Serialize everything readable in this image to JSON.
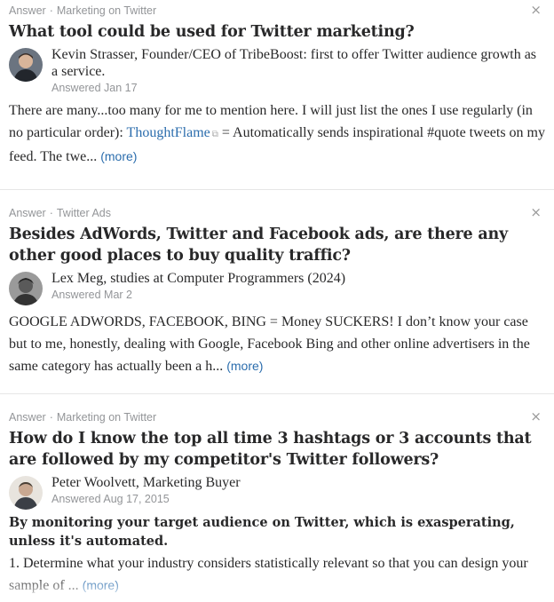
{
  "cards": [
    {
      "type_label": "Answer",
      "topic": "Marketing on Twitter",
      "close_glyph": "×",
      "question": "What tool could be used for Twitter marketing?",
      "author": "Kevin Strasser, Founder/CEO of TribeBoost: first to offer Twitter audience growth as a service.",
      "answered": "Answered Jan 17",
      "body_before_link": "There are many...too many for me to mention here. I will just list the ones I use regularly (in no particular order): ",
      "link_text": "ThoughtFlame",
      "body_after_link": " = Automatically sends inspirational #quote tweets on my feed. The twe... ",
      "more": "(more)"
    },
    {
      "type_label": "Answer",
      "topic": "Twitter Ads",
      "close_glyph": "×",
      "question": "Besides AdWords, Twitter and Facebook ads, are there any other good places to buy quality traffic?",
      "author": "Lex Meg, studies at Computer Programmers (2024)",
      "answered": "Answered Mar 2",
      "body": "GOOGLE ADWORDS, FACEBOOK, BING = Money SUCKERS! I don’t know your case but to me, honestly, dealing with Google, Facebook Bing and other online advertisers in the same category has actually been a h... ",
      "more": "(more)"
    },
    {
      "type_label": "Answer",
      "topic": "Marketing on Twitter",
      "close_glyph": "×",
      "question": "How do I know the top all time 3 hashtags or 3 accounts that are followed by my competitor's Twitter followers?",
      "author": "Peter Woolvett, Marketing Buyer",
      "answered": "Answered Aug 17, 2015",
      "lead": "By monitoring your target audience on Twitter, which is exasperating, unless it's automated.",
      "body": "1. Determine what your industry considers statistically relevant so that you can design your sample of ... ",
      "more": "(more)"
    }
  ],
  "icons": {
    "close": "close-icon",
    "external_link": "external-link-icon",
    "avatar": "avatar"
  },
  "colors": {
    "link": "#2b6dad",
    "meta": "#939598",
    "text": "#282829"
  }
}
